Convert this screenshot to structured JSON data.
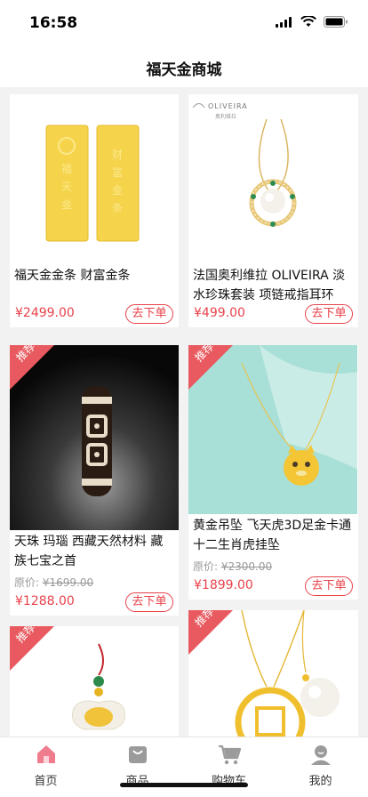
{
  "status": {
    "time": "16:58"
  },
  "header": {
    "title": "福天金商城"
  },
  "products": [
    {
      "title": "福天金金条 财富金条",
      "price": "¥2499.00",
      "button": "去下单",
      "img_text_left": "福天金",
      "img_text_right": "财富金条"
    },
    {
      "title": "法国奥利维拉 OLIVEIRA 淡水珍珠套装 项链戒指耳环",
      "price": "¥499.00",
      "button": "去下单",
      "brand": "OLIVEIRA",
      "brand_sub": "奥利维拉"
    },
    {
      "badge": "推荐",
      "title": "天珠 玛瑙 西藏天然材料 藏族七宝之首",
      "orig_label": "原价:",
      "orig_price": "¥1699.00",
      "price": "¥1288.00",
      "button": "去下单"
    },
    {
      "badge": "推荐",
      "title": "黄金吊坠 飞天虎3D足金卡通十二生肖虎挂坠",
      "orig_label": "原价:",
      "orig_price": "¥2300.00",
      "price": "¥1899.00",
      "button": "去下单"
    },
    {
      "badge": "推荐"
    },
    {
      "badge": "推荐"
    }
  ],
  "tabbar": {
    "items": [
      {
        "label": "首页",
        "icon": "home-icon",
        "active": true
      },
      {
        "label": "商品",
        "icon": "bag-icon"
      },
      {
        "label": "购物车",
        "icon": "cart-icon"
      },
      {
        "label": "我的",
        "icon": "profile-icon"
      }
    ]
  },
  "colors": {
    "accent": "#e8424a",
    "badge": "#e85a5f",
    "active_tab": "#ef7d8e"
  }
}
